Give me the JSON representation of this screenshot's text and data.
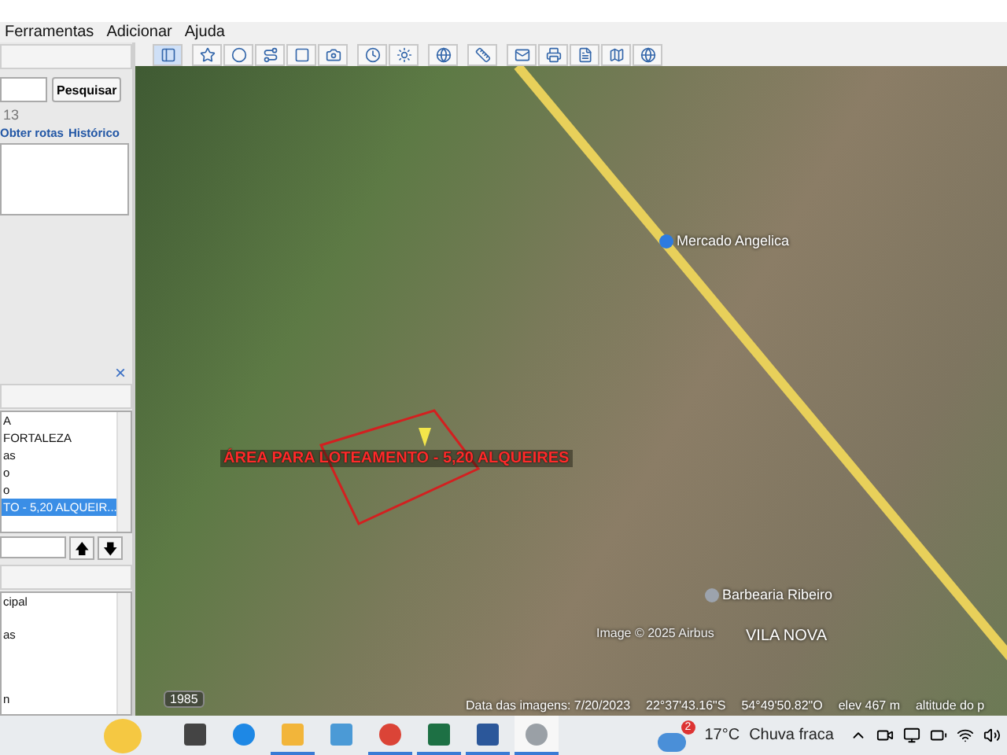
{
  "menu": [
    "Ferramentas",
    "Adicionar",
    "Ajuda"
  ],
  "search": {
    "button": "Pesquisar",
    "hint": "13",
    "links": [
      "Obter rotas",
      "Histórico"
    ]
  },
  "places": {
    "items": [
      {
        "label": "A",
        "selected": false
      },
      {
        "label": "FORTALEZA",
        "selected": false
      },
      {
        "label": "as",
        "selected": false
      },
      {
        "label": "o",
        "selected": false
      },
      {
        "label": "o",
        "selected": false
      },
      {
        "label": "TO - 5,20 ALQUEIR...",
        "selected": true
      }
    ],
    "up": "🡅",
    "down": "🡇",
    "close": "×"
  },
  "layers": {
    "items": [
      "cipal",
      "as",
      "n"
    ]
  },
  "map": {
    "area_label": "ÁREA PARA LOTEAMENTO - 5,20 ALQUEIRES",
    "pois": [
      {
        "label": "Mercado Angelica",
        "kind": "shop"
      },
      {
        "label": "Barbearia Ribeiro",
        "kind": "service"
      }
    ],
    "district": "VILA NOVA",
    "credit": "Image © 2025 Airbus",
    "year": "1985",
    "status": [
      "Data das imagens: 7/20/2023",
      "22°37'43.16\"S",
      "54°49'50.82\"O",
      "elev  467 m",
      "altitude do p"
    ]
  },
  "taskbar": {
    "apps": [
      {
        "running": false,
        "selected": false
      },
      {
        "running": false,
        "selected": false
      },
      {
        "running": true,
        "selected": false
      },
      {
        "running": false,
        "selected": false
      },
      {
        "running": true,
        "selected": false
      },
      {
        "running": true,
        "selected": false
      },
      {
        "running": true,
        "selected": false
      },
      {
        "running": true,
        "selected": true
      }
    ],
    "weather_badge": "2",
    "temperature": "17°C",
    "condition": "Chuva fraca"
  }
}
